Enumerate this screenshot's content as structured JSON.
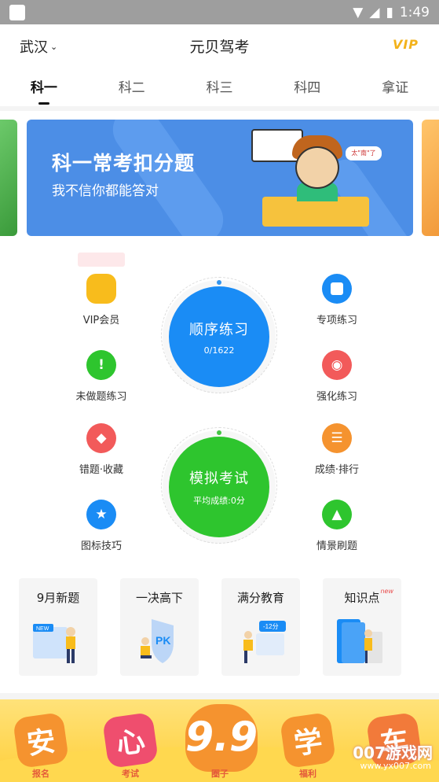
{
  "status": {
    "time": "1:49"
  },
  "header": {
    "city": "武汉",
    "title": "元贝驾考",
    "vip": "VIP"
  },
  "tabs": [
    {
      "label": "科一"
    },
    {
      "label": "科二"
    },
    {
      "label": "科三"
    },
    {
      "label": "科四"
    },
    {
      "label": "拿证"
    }
  ],
  "banner": {
    "headline": "科一常考扣分题",
    "subline": "我不信你都能答对",
    "bubble": "太\"南\"了"
  },
  "menu": {
    "vip_member": "VIP会员",
    "special_practice": "专项练习",
    "unanswered": "未做题练习",
    "intensive": "强化练习",
    "mistakes_favorites": "错题·收藏",
    "score_rank": "成绩·排行",
    "icon_tips": "图标技巧",
    "scenario": "情景刷题"
  },
  "sequential": {
    "title": "顺序练习",
    "progress": "0/1622"
  },
  "mock_exam": {
    "title": "模拟考试",
    "average": "平均成绩:0分"
  },
  "cards": [
    {
      "title": "9月新题",
      "badge": "NEW"
    },
    {
      "title": "一决高下",
      "badge": "PK"
    },
    {
      "title": "满分教育",
      "badge": "-12分"
    },
    {
      "title": "知识点",
      "badge": "new"
    }
  ],
  "bottom_nav": [
    {
      "glyph": "安",
      "label": "报名"
    },
    {
      "glyph": "心",
      "label": "考试"
    },
    {
      "glyph": "9.9",
      "label": "圈子"
    },
    {
      "glyph": "学",
      "label": "福利"
    },
    {
      "glyph": "车",
      "label": ""
    }
  ],
  "watermark": {
    "main": "007游戏网",
    "url": "www.yx007.com"
  },
  "colors": {
    "blue": "#1a8cf5",
    "green": "#2ec52e",
    "yellow": "#f8bc1c",
    "red": "#f25a5a",
    "orange": "#f5932f"
  }
}
